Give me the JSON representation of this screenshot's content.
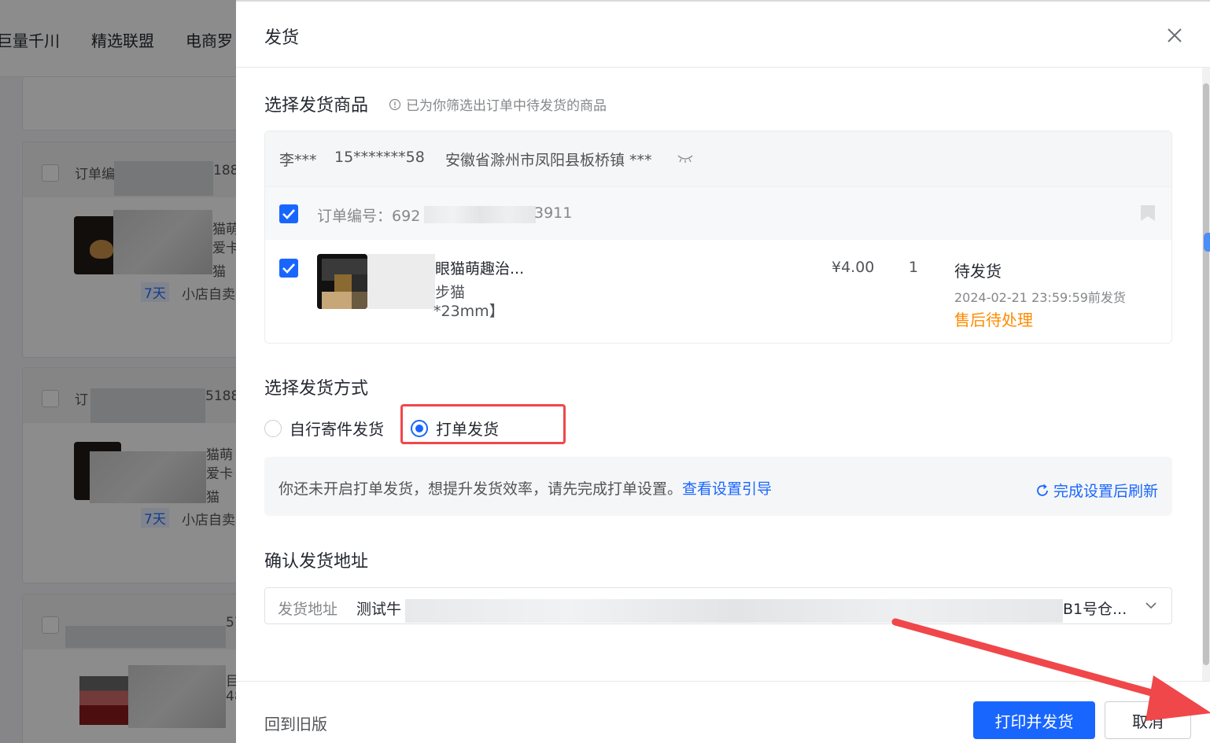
{
  "background": {
    "nav_items": [
      "巨量千川",
      "精选联盟",
      "电商罗"
    ],
    "cards": [
      {
        "order_prefix": "订单编",
        "order_suffix": "188",
        "name_lines": [
          "猫萌",
          "爱卡"
        ],
        "badge": "7天",
        "tag": "小店自卖",
        "sub": "猫"
      },
      {
        "order_prefix": "订",
        "order_suffix": "5188",
        "name_lines": [
          "猫萌",
          "爱卡"
        ],
        "badge": "7天",
        "tag": "小店自卖",
        "sub": "猫"
      },
      {
        "order_prefix": "",
        "order_suffix": "57",
        "name_lines": [
          "目",
          "48"
        ],
        "badge": "",
        "tag": "",
        "sub": ""
      }
    ]
  },
  "drawer": {
    "title": "发货",
    "close_icon": "close-icon"
  },
  "select_goods": {
    "title": "选择发货商品",
    "hint": "已为你筛选出订单中待发货的商品",
    "buyer": {
      "name": "李***",
      "phone": "15*******58",
      "address": "安徽省滁州市凤阳县板桥镇 ***"
    },
    "order": {
      "label": "订单编号：",
      "number_start": "692",
      "number_end": "3911",
      "checked": true
    },
    "item": {
      "title": "眼猫萌趣治...",
      "spec": "步猫",
      "size": "*23mm】",
      "price": "¥4.00",
      "quantity": "1",
      "status": "待发货",
      "deadline": "2024-02-21 23:59:59前发货",
      "aftersale": "售后待处理",
      "checked": true
    }
  },
  "ship_method": {
    "title": "选择发货方式",
    "options": [
      {
        "label": "自行寄件发货",
        "selected": false
      },
      {
        "label": "打单发货",
        "selected": true
      }
    ],
    "notice": "你还未开启打单发货，想提升发货效率，请先完成打单设置。",
    "notice_link": "查看设置引导",
    "refresh": "完成设置后刷新"
  },
  "address": {
    "title": "确认发货地址",
    "label": "发货地址",
    "value_start": "测试牛",
    "value_end": "B1号仓..."
  },
  "footer": {
    "old_version": "回到旧版",
    "primary": "打印并发货",
    "cancel": "取消"
  },
  "colors": {
    "primary": "#1966ff",
    "warning": "#ff8a00",
    "highlight": "#f0474b"
  }
}
